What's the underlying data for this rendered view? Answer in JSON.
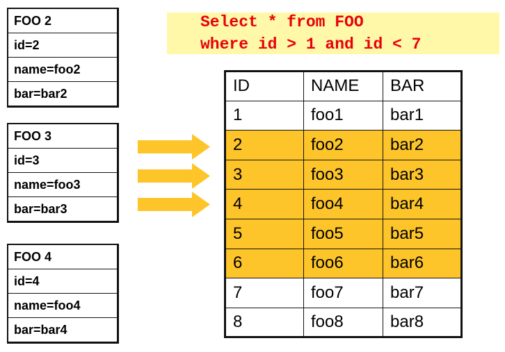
{
  "objects": [
    {
      "title": "FOO 2",
      "fields": [
        "id=2",
        "name=foo2",
        "bar=bar2"
      ]
    },
    {
      "title": "FOO 3",
      "fields": [
        "id=3",
        "name=foo3",
        "bar=bar3"
      ]
    },
    {
      "title": "FOO 4",
      "fields": [
        "id=4",
        "name=foo4",
        "bar=bar4"
      ]
    }
  ],
  "query": {
    "line1": "Select * from FOO",
    "line2": "where id > 1 and id < 7",
    "background": "#fff8a8",
    "text_color": "#e8000c"
  },
  "arrows": {
    "count": 3,
    "color": "#fdc52a"
  },
  "table": {
    "headers": [
      "ID",
      "NAME",
      "BAR"
    ],
    "highlight_color": "#fdc52a",
    "rows": [
      {
        "cells": [
          "1",
          "foo1",
          "bar1"
        ],
        "highlighted": false
      },
      {
        "cells": [
          "2",
          "foo2",
          "bar2"
        ],
        "highlighted": true
      },
      {
        "cells": [
          "3",
          "foo3",
          "bar3"
        ],
        "highlighted": true
      },
      {
        "cells": [
          "4",
          "foo4",
          "bar4"
        ],
        "highlighted": true
      },
      {
        "cells": [
          "5",
          "foo5",
          "bar5"
        ],
        "highlighted": true
      },
      {
        "cells": [
          "6",
          "foo6",
          "bar6"
        ],
        "highlighted": true
      },
      {
        "cells": [
          "7",
          "foo7",
          "bar7"
        ],
        "highlighted": false
      },
      {
        "cells": [
          "8",
          "foo8",
          "bar8"
        ],
        "highlighted": false
      }
    ]
  }
}
